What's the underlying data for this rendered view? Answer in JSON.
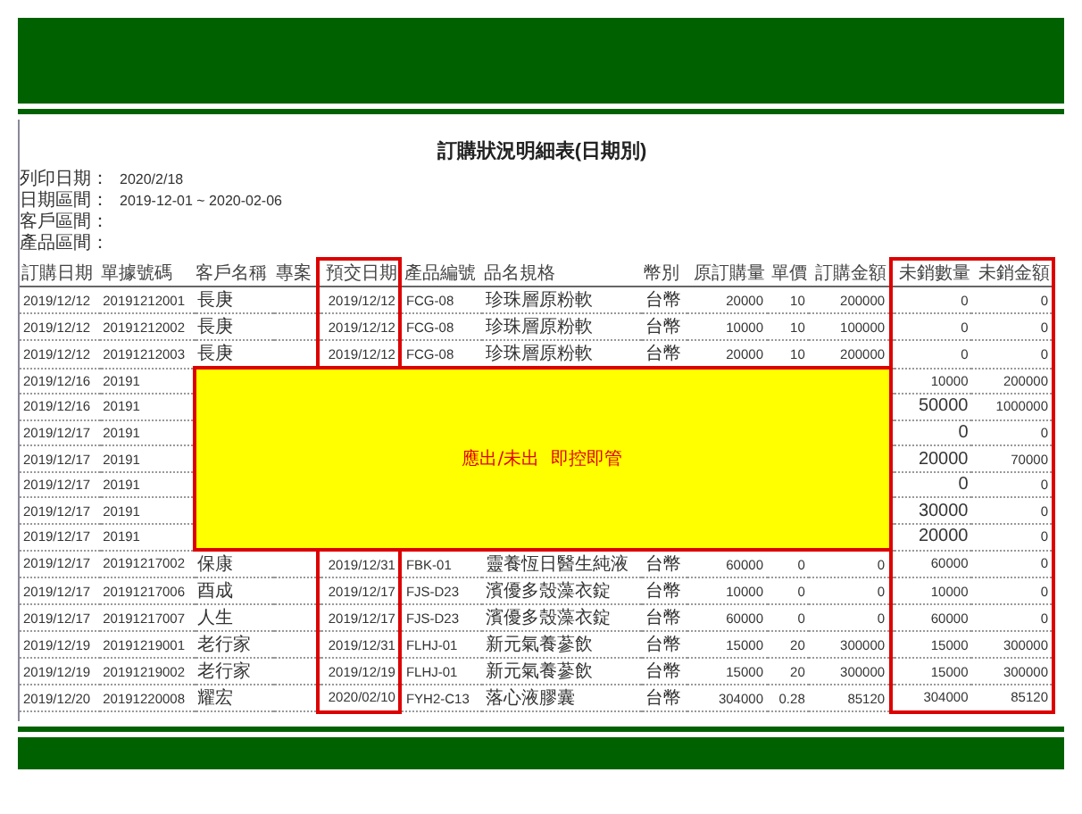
{
  "report": {
    "title": "訂購狀況明細表(日期別)",
    "filters": [
      {
        "label": "列印日期：",
        "value": "2020/2/18"
      },
      {
        "label": "日期區間：",
        "value": "2019-12-01 ~ 2020-02-06"
      },
      {
        "label": "客戶區間："
      },
      {
        "label": "產品區間："
      }
    ]
  },
  "table": {
    "columns": [
      {
        "label": "訂購日期",
        "highlighted": false
      },
      {
        "label": "單據號碼",
        "highlighted": false
      },
      {
        "label": "客戶名稱",
        "highlighted": false
      },
      {
        "label": "專案",
        "highlighted": false
      },
      {
        "label": "預交日期",
        "highlighted": true
      },
      {
        "label": "產品編號",
        "highlighted": false
      },
      {
        "label": "品名規格",
        "highlighted": false
      },
      {
        "label": "幣別",
        "highlighted": false
      },
      {
        "label": "原訂購量",
        "highlighted": false
      },
      {
        "label": "單價",
        "highlighted": false
      },
      {
        "label": "訂購金額",
        "highlighted": false
      },
      {
        "label": "未銷數量",
        "highlighted": true
      },
      {
        "label": "未銷金額",
        "highlighted": true
      }
    ],
    "rows": [
      {
        "covered": false,
        "cells": [
          "2019/12/12",
          "20191212001",
          "長庚",
          null,
          "2019/12/12",
          "FCG-08",
          "珍珠層原粉軟",
          "台幣",
          "20000",
          "10",
          "200000",
          "0",
          "0"
        ]
      },
      {
        "covered": false,
        "cells": [
          "2019/12/12",
          "20191212002",
          "長庚",
          null,
          "2019/12/12",
          "FCG-08",
          "珍珠層原粉軟",
          "台幣",
          "10000",
          "10",
          "100000",
          "0",
          "0"
        ]
      },
      {
        "covered": false,
        "cells": [
          "2019/12/12",
          "20191212003",
          "長庚",
          null,
          "2019/12/12",
          "FCG-08",
          "珍珠層原粉軟",
          "台幣",
          "20000",
          "10",
          "200000",
          "0",
          "0"
        ]
      },
      {
        "covered": true,
        "cells": [
          "2019/12/16",
          "20191",
          "10000",
          "200000"
        ]
      },
      {
        "covered": true,
        "cells": [
          "2019/12/16",
          "20191",
          "50000",
          "1000000"
        ]
      },
      {
        "covered": true,
        "cells": [
          "2019/12/17",
          "20191",
          "0",
          "0"
        ]
      },
      {
        "covered": true,
        "cells": [
          "2019/12/17",
          "20191",
          "20000",
          "70000"
        ]
      },
      {
        "covered": true,
        "cells": [
          "2019/12/17",
          "20191",
          "0",
          "0"
        ]
      },
      {
        "covered": true,
        "cells": [
          "2019/12/17",
          "20191",
          "30000",
          "0"
        ]
      },
      {
        "covered": true,
        "cells": [
          "2019/12/17",
          "20191",
          "20000",
          "0"
        ]
      },
      {
        "covered": false,
        "cells": [
          "2019/12/17",
          "20191217002",
          "保康",
          null,
          "2019/12/31",
          "FBK-01",
          "靈養恆日醫生純液",
          "台幣",
          "60000",
          "0",
          "0",
          "60000",
          "0"
        ]
      },
      {
        "covered": false,
        "cells": [
          "2019/12/17",
          "20191217006",
          "酉成",
          null,
          "2019/12/17",
          "FJS-D23",
          "濱優多殼藻衣錠",
          "台幣",
          "10000",
          "0",
          "0",
          "10000",
          "0"
        ]
      },
      {
        "covered": false,
        "cells": [
          "2019/12/17",
          "20191217007",
          "人生",
          null,
          "2019/12/17",
          "FJS-D23",
          "濱優多殼藻衣錠",
          "台幣",
          "60000",
          "0",
          "0",
          "60000",
          "0"
        ]
      },
      {
        "covered": false,
        "cells": [
          "2019/12/19",
          "20191219001",
          "老行家",
          null,
          "2019/12/31",
          "FLHJ-01",
          "新元氣養蔘飲",
          "台幣",
          "15000",
          "20",
          "300000",
          "15000",
          "300000"
        ]
      },
      {
        "covered": false,
        "cells": [
          "2019/12/19",
          "20191219002",
          "老行家",
          null,
          "2019/12/19",
          "FLHJ-01",
          "新元氣養蔘飲",
          "台幣",
          "15000",
          "20",
          "300000",
          "15000",
          "300000"
        ]
      },
      {
        "covered": false,
        "cells": [
          "2019/12/20",
          "20191220008",
          "耀宏",
          null,
          "2020/02/10",
          "FYH2-C13",
          "落心液膠囊",
          "台幣",
          "304000",
          "0.28",
          "85120",
          "304000",
          "85120"
        ]
      }
    ]
  },
  "callout": {
    "text": "應出/未出  即控即管"
  }
}
